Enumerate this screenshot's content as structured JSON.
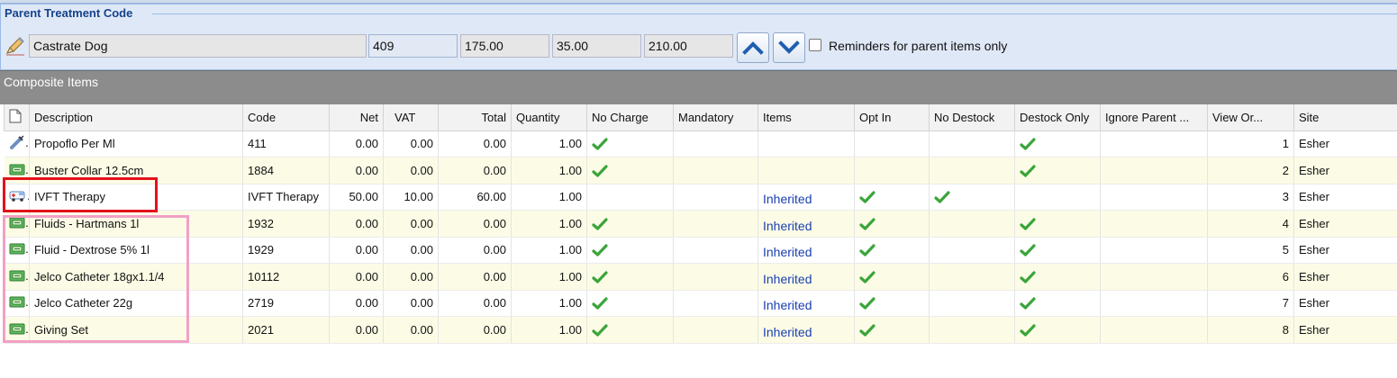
{
  "parent": {
    "title": "Parent Treatment Code",
    "description": "Castrate Dog",
    "code": "409",
    "net": "175.00",
    "vat": "35.00",
    "total": "210.00",
    "reminders_label": "Reminders for parent items only",
    "reminders_checked": false
  },
  "composite": {
    "title": "Composite Items",
    "columns": {
      "description": "Description",
      "code": "Code",
      "net": "Net",
      "vat": "VAT",
      "total": "Total",
      "quantity": "Quantity",
      "no_charge": "No Charge",
      "mandatory": "Mandatory",
      "items": "Items",
      "opt_in": "Opt In",
      "no_destock": "No Destock",
      "destock_only": "Destock Only",
      "ignore_parent": "Ignore Parent ...",
      "view_order": "View Or...",
      "site": "Site"
    },
    "rows": [
      {
        "icon": "syringe-icon",
        "description": "Propoflo Per Ml",
        "code": "411",
        "net": "0.00",
        "vat": "0.00",
        "total": "0.00",
        "quantity": "1.00",
        "no_charge": true,
        "mandatory": false,
        "items": "",
        "opt_in": false,
        "no_destock": false,
        "destock_only": true,
        "view_order": "1",
        "site": "Esher"
      },
      {
        "icon": "medicine-pack-icon",
        "description": "Buster Collar 12.5cm",
        "code": "1884",
        "net": "0.00",
        "vat": "0.00",
        "total": "0.00",
        "quantity": "1.00",
        "no_charge": true,
        "mandatory": false,
        "items": "",
        "opt_in": false,
        "no_destock": false,
        "destock_only": true,
        "view_order": "2",
        "site": "Esher"
      },
      {
        "icon": "ambulance-icon",
        "description": "IVFT Therapy",
        "code": "IVFT Therapy",
        "net": "50.00",
        "vat": "10.00",
        "total": "60.00",
        "quantity": "1.00",
        "no_charge": false,
        "mandatory": false,
        "items": "Inherited",
        "opt_in": true,
        "no_destock": true,
        "destock_only": false,
        "view_order": "3",
        "site": "Esher"
      },
      {
        "icon": "medicine-pack-icon",
        "description": "Fluids - Hartmans 1l",
        "code": "1932",
        "net": "0.00",
        "vat": "0.00",
        "total": "0.00",
        "quantity": "1.00",
        "no_charge": true,
        "mandatory": false,
        "items": "Inherited",
        "opt_in": true,
        "no_destock": false,
        "destock_only": true,
        "view_order": "4",
        "site": "Esher"
      },
      {
        "icon": "medicine-pack-icon",
        "description": "Fluid - Dextrose 5% 1l",
        "code": "1929",
        "net": "0.00",
        "vat": "0.00",
        "total": "0.00",
        "quantity": "1.00",
        "no_charge": true,
        "mandatory": false,
        "items": "Inherited",
        "opt_in": true,
        "no_destock": false,
        "destock_only": true,
        "view_order": "5",
        "site": "Esher"
      },
      {
        "icon": "medicine-pack-icon",
        "description": "Jelco Catheter 18gx1.1/4",
        "code": "10112",
        "net": "0.00",
        "vat": "0.00",
        "total": "0.00",
        "quantity": "1.00",
        "no_charge": true,
        "mandatory": false,
        "items": "Inherited",
        "opt_in": true,
        "no_destock": false,
        "destock_only": true,
        "view_order": "6",
        "site": "Esher"
      },
      {
        "icon": "medicine-pack-icon",
        "description": "Jelco Catheter 22g",
        "code": "2719",
        "net": "0.00",
        "vat": "0.00",
        "total": "0.00",
        "quantity": "1.00",
        "no_charge": true,
        "mandatory": false,
        "items": "Inherited",
        "opt_in": true,
        "no_destock": false,
        "destock_only": true,
        "view_order": "7",
        "site": "Esher"
      },
      {
        "icon": "medicine-pack-icon",
        "description": "Giving Set",
        "code": "2021",
        "net": "0.00",
        "vat": "0.00",
        "total": "0.00",
        "quantity": "1.00",
        "no_charge": true,
        "mandatory": false,
        "items": "Inherited",
        "opt_in": true,
        "no_destock": false,
        "destock_only": true,
        "view_order": "8",
        "site": "Esher"
      }
    ]
  },
  "colors": {
    "panel_bg": "#dfe8f6",
    "title_blue": "#15428b",
    "composite_bar": "#8c8c8c",
    "alt_row": "#fcfce6",
    "inherited_text": "#1a3fb0",
    "tick_green": "#3aa53a",
    "highlight_red": "#e1121b",
    "highlight_pink": "#f2a0c4"
  }
}
